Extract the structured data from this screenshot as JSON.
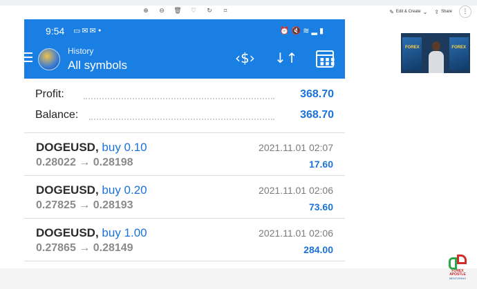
{
  "viewer": {
    "tools": [
      "zoom-in-icon",
      "zoom-out-icon",
      "delete-icon",
      "favorite-icon",
      "rotate-icon",
      "crop-icon"
    ],
    "edit_create_label": "Edit & Create",
    "share_label": "Share"
  },
  "webcam": {
    "logo_left": "FOREX",
    "logo_right": "FOREX"
  },
  "status_bar": {
    "time": "9:54"
  },
  "app_bar": {
    "title_small": "History",
    "title_big": "All symbols"
  },
  "summary": {
    "profit_label": "Profit:",
    "profit_value": "368.70",
    "balance_label": "Balance:",
    "balance_value": "368.70"
  },
  "trades": [
    {
      "symbol": "DOGEUSD,",
      "side": "buy 0.10",
      "prices": "0.28022 → 0.28198",
      "date": "2021.11.01 02:07",
      "profit": "17.60"
    },
    {
      "symbol": "DOGEUSD,",
      "side": "buy 0.20",
      "prices": "0.27825 → 0.28193",
      "date": "2021.11.01 02:06",
      "profit": "73.60"
    },
    {
      "symbol": "DOGEUSD,",
      "side": "buy 1.00",
      "prices": "0.27865 → 0.28149",
      "date": "2021.11.01 02:06",
      "profit": "284.00"
    }
  ],
  "brand": {
    "line1": "FOREX",
    "line2": "APOSTLE",
    "line3": "MENTORING"
  },
  "colors": {
    "accent": "#1a7fe3",
    "value_blue": "#1a72d9"
  }
}
